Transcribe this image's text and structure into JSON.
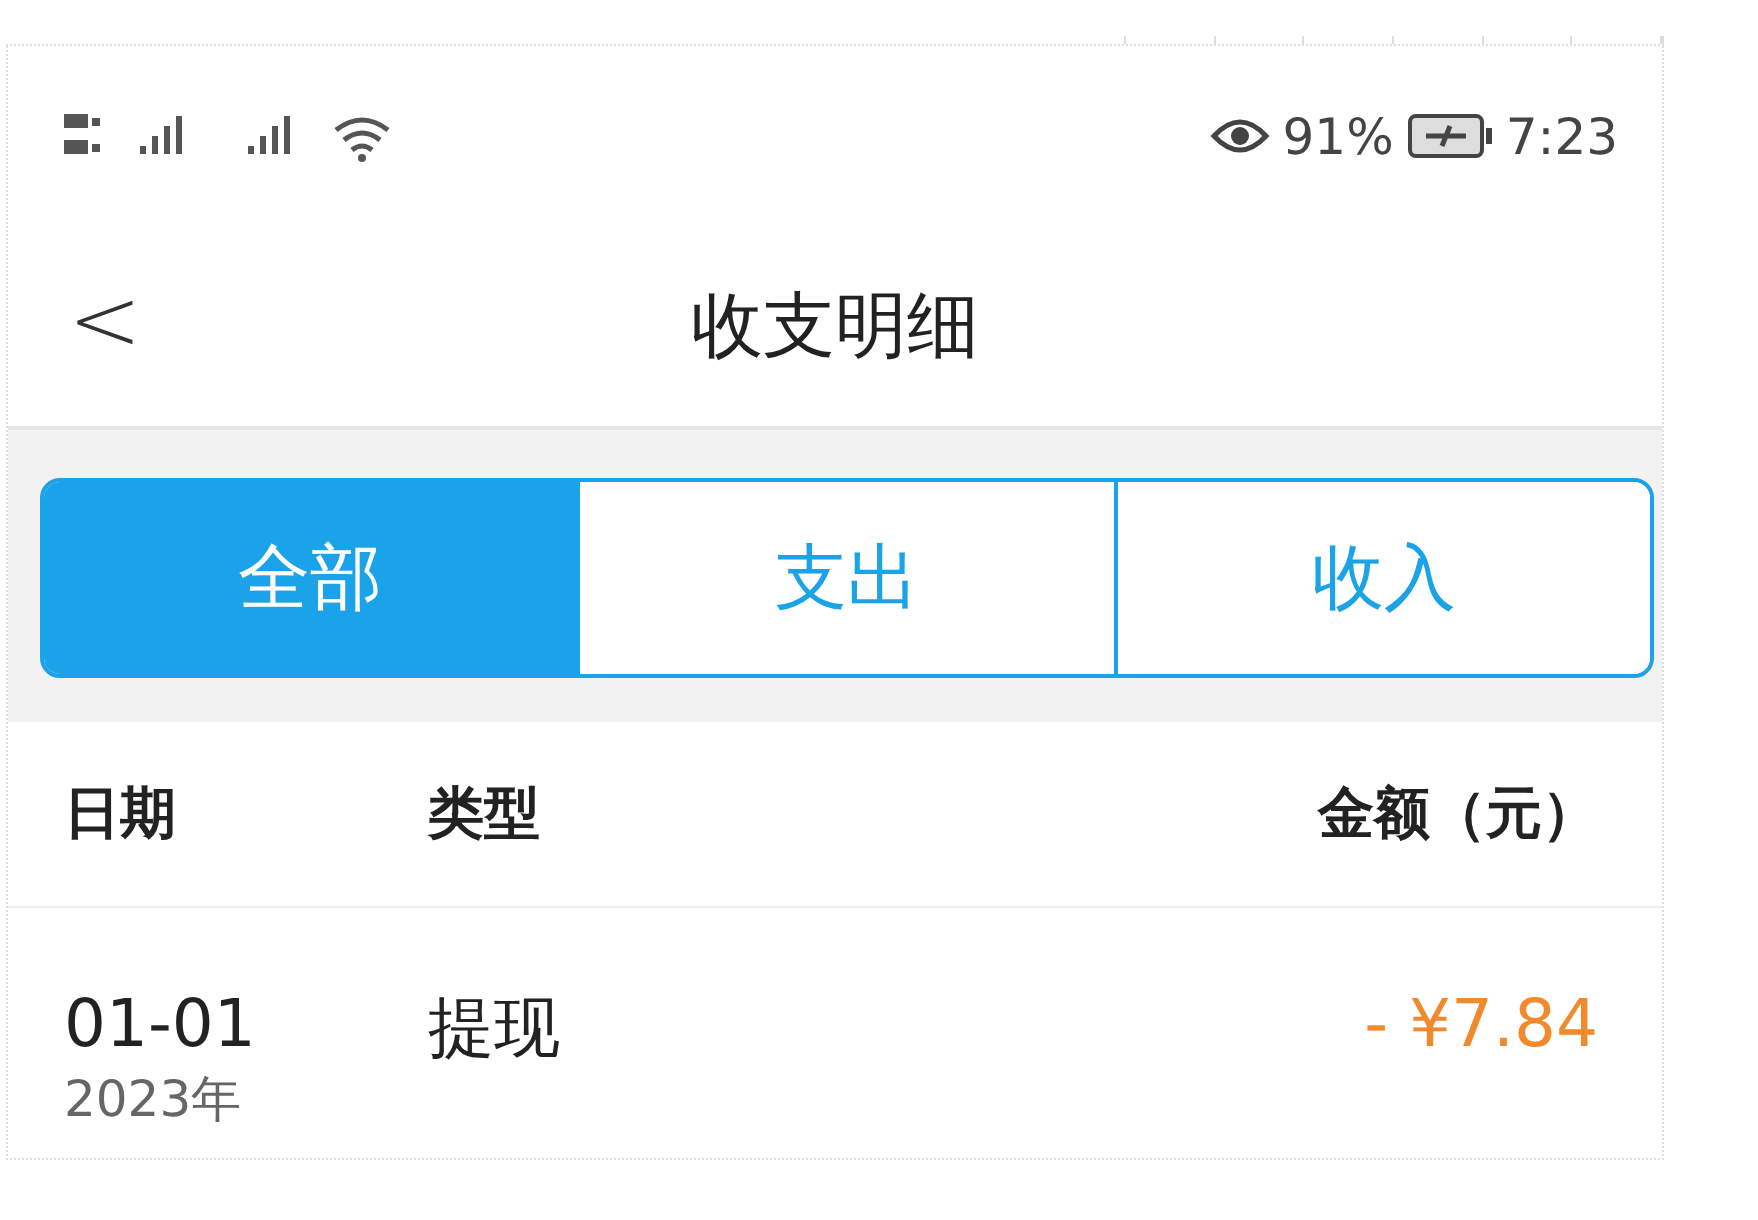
{
  "status_bar": {
    "battery": "91%",
    "time": "7:23"
  },
  "header": {
    "back": "<",
    "title": "收支明细"
  },
  "tabs": [
    {
      "label": "全部",
      "selected": true
    },
    {
      "label": "支出",
      "selected": false
    },
    {
      "label": "收入",
      "selected": false
    }
  ],
  "table": {
    "columns": [
      "日期",
      "类型",
      "金额（元）"
    ],
    "rows": [
      {
        "date": "01-01",
        "year": "2023年",
        "type": "提现",
        "amount": "- ¥7.84",
        "kind": "expense"
      }
    ]
  }
}
